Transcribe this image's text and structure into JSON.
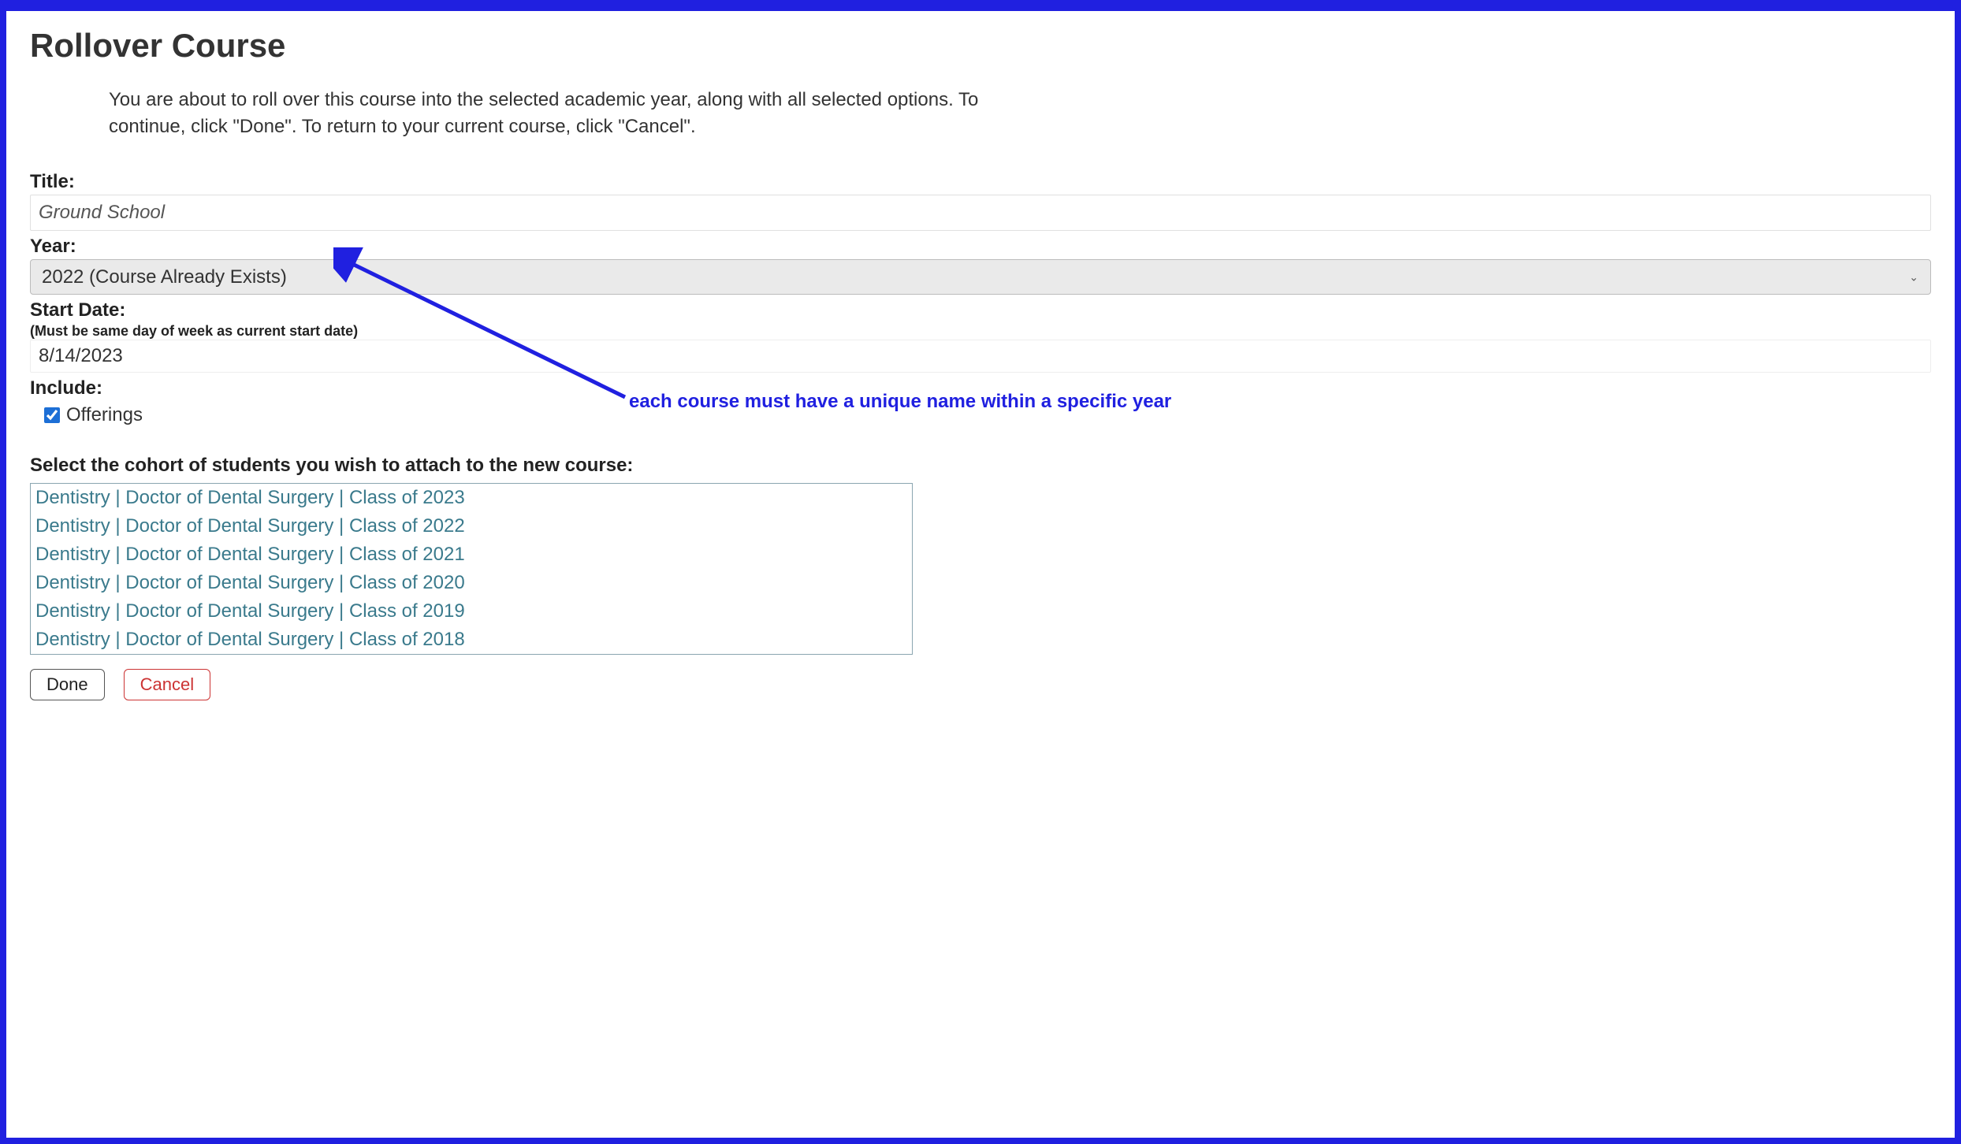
{
  "page": {
    "title": "Rollover Course",
    "intro": "You are about to roll over this course into the selected academic year, along with all selected options. To continue, click \"Done\". To return to your current course, click \"Cancel\"."
  },
  "fields": {
    "title_label": "Title:",
    "title_value": "Ground School",
    "year_label": "Year:",
    "year_value": "2022 (Course Already Exists)",
    "start_date_label": "Start Date:",
    "start_date_hint": "(Must be same day of week as current start date)",
    "start_date_value": "8/14/2023",
    "include_label": "Include:",
    "offerings_label": "Offerings",
    "offerings_checked": true
  },
  "cohort": {
    "heading": "Select the cohort of students you wish to attach to the new course:",
    "items": [
      "Dentistry | Doctor of Dental Surgery | Class of 2023",
      "Dentistry | Doctor of Dental Surgery | Class of 2022",
      "Dentistry | Doctor of Dental Surgery | Class of 2021",
      "Dentistry | Doctor of Dental Surgery | Class of 2020",
      "Dentistry | Doctor of Dental Surgery | Class of 2019",
      "Dentistry | Doctor of Dental Surgery | Class of 2018"
    ]
  },
  "buttons": {
    "done": "Done",
    "cancel": "Cancel"
  },
  "annotation": {
    "text": "each course must have a unique name within a specific year"
  }
}
